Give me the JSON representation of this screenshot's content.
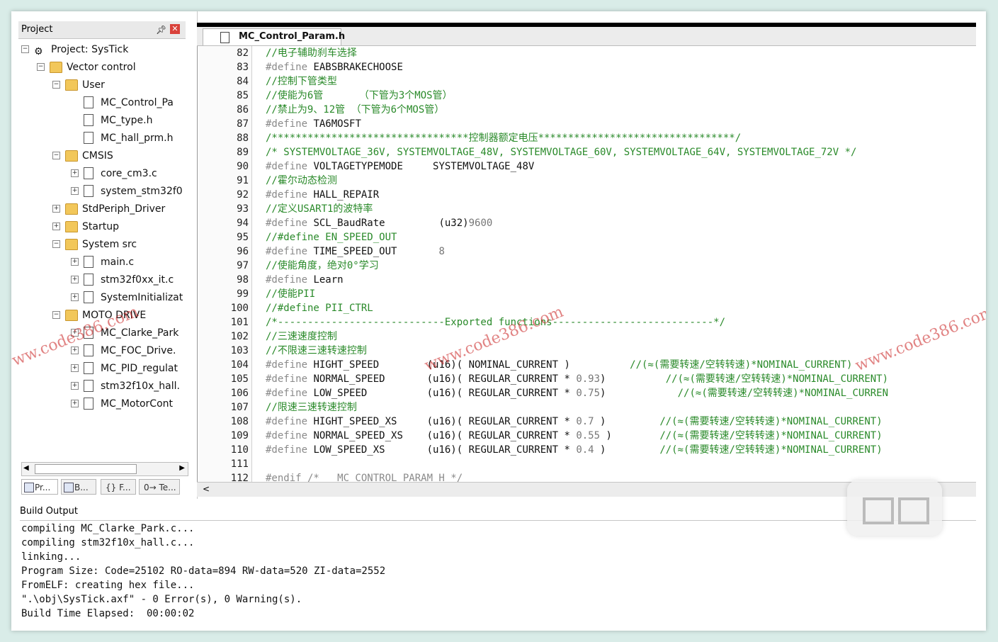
{
  "project_pane": {
    "title": "Project",
    "tree": [
      {
        "label": "Project: SysTick",
        "icon": "project-icon"
      },
      {
        "label": "Vector control",
        "icon": "folder-icon"
      },
      {
        "label": "User",
        "icon": "folder-icon"
      },
      {
        "label": "MC_Control_Pa",
        "icon": "file-icon"
      },
      {
        "label": "MC_type.h",
        "icon": "file-icon"
      },
      {
        "label": "MC_hall_prm.h",
        "icon": "file-icon"
      },
      {
        "label": "CMSIS",
        "icon": "folder-icon"
      },
      {
        "label": "core_cm3.c",
        "icon": "file-icon"
      },
      {
        "label": "system_stm32f0",
        "icon": "file-icon"
      },
      {
        "label": "StdPeriph_Driver",
        "icon": "folder-icon"
      },
      {
        "label": "Startup",
        "icon": "folder-icon"
      },
      {
        "label": "System src",
        "icon": "folder-icon"
      },
      {
        "label": "main.c",
        "icon": "file-icon"
      },
      {
        "label": "stm32f0xx_it.c",
        "icon": "file-icon"
      },
      {
        "label": "SystemInitializat",
        "icon": "file-icon"
      },
      {
        "label": "MOTO DRIVE",
        "icon": "folder-icon"
      },
      {
        "label": "MC_Clarke_Park",
        "icon": "file-icon"
      },
      {
        "label": "MC_FOC_Drive.",
        "icon": "file-icon"
      },
      {
        "label": "MC_PID_regulat",
        "icon": "file-icon"
      },
      {
        "label": "stm32f10x_hall.",
        "icon": "file-icon"
      },
      {
        "label": "MC_MotorCont",
        "icon": "file-icon"
      }
    ],
    "tabs": [
      "Pr...",
      "B...",
      "{} F...",
      "0→ Te..."
    ]
  },
  "editor": {
    "file_tab": "MC_Control_Param.h",
    "lines": [
      {
        "n": "82",
        "segs": [
          {
            "t": "//电子辅助刹车选择",
            "c": "cmt"
          }
        ]
      },
      {
        "n": "83",
        "segs": [
          {
            "t": "#define ",
            "c": "define"
          },
          {
            "t": "EABSBRAKECHOOSE",
            "c": "code"
          }
        ]
      },
      {
        "n": "84",
        "segs": [
          {
            "t": "//控制下管类型",
            "c": "cmt"
          }
        ]
      },
      {
        "n": "85",
        "segs": [
          {
            "t": "//使能为6管      （下管为3个MOS管）",
            "c": "cmt"
          }
        ]
      },
      {
        "n": "86",
        "segs": [
          {
            "t": "//禁止为9、12管 （下管为6个MOS管）",
            "c": "cmt"
          }
        ]
      },
      {
        "n": "87",
        "segs": [
          {
            "t": "#define ",
            "c": "define"
          },
          {
            "t": "TA6MOSFT",
            "c": "code"
          }
        ]
      },
      {
        "n": "88",
        "segs": [
          {
            "t": "/*********************************控制器额定电压*********************************/",
            "c": "cmt"
          }
        ]
      },
      {
        "n": "89",
        "segs": [
          {
            "t": "/* SYSTEMVOLTAGE_36V, SYSTEMVOLTAGE_48V, SYSTEMVOLTAGE_60V, SYSTEMVOLTAGE_64V, SYSTEMVOLTAGE_72V */",
            "c": "cmt"
          }
        ]
      },
      {
        "n": "90",
        "segs": [
          {
            "t": "#define ",
            "c": "define"
          },
          {
            "t": "VOLTAGETYPEMODE     SYSTEMVOLTAGE_48V",
            "c": "code"
          }
        ]
      },
      {
        "n": "91",
        "segs": [
          {
            "t": "//霍尔动态检测",
            "c": "cmt"
          }
        ]
      },
      {
        "n": "92",
        "segs": [
          {
            "t": "#define ",
            "c": "define"
          },
          {
            "t": "HALL_REPAIR",
            "c": "code"
          }
        ]
      },
      {
        "n": "93",
        "segs": [
          {
            "t": "//定义USART1的波特率",
            "c": "cmt"
          }
        ]
      },
      {
        "n": "94",
        "segs": [
          {
            "t": "#define ",
            "c": "define"
          },
          {
            "t": "SCL_BaudRate         (u32)",
            "c": "code"
          },
          {
            "t": "9600",
            "c": "num"
          }
        ]
      },
      {
        "n": "95",
        "segs": [
          {
            "t": "//#define EN_SPEED_OUT",
            "c": "cmt"
          }
        ]
      },
      {
        "n": "96",
        "segs": [
          {
            "t": "#define ",
            "c": "define"
          },
          {
            "t": "TIME_SPEED_OUT       ",
            "c": "code"
          },
          {
            "t": "8",
            "c": "num"
          }
        ]
      },
      {
        "n": "97",
        "segs": [
          {
            "t": "//使能角度，绝对0°学习",
            "c": "cmt"
          }
        ]
      },
      {
        "n": "98",
        "segs": [
          {
            "t": "#define ",
            "c": "define"
          },
          {
            "t": "Learn",
            "c": "code"
          }
        ]
      },
      {
        "n": "99",
        "segs": [
          {
            "t": "//使能PII",
            "c": "cmt"
          }
        ]
      },
      {
        "n": "100",
        "segs": [
          {
            "t": "//#define PII_CTRL",
            "c": "cmt"
          }
        ]
      },
      {
        "n": "101",
        "segs": [
          {
            "t": "/*----------------------------Exported functions---------------------------*/",
            "c": "cmt"
          }
        ]
      },
      {
        "n": "102",
        "segs": [
          {
            "t": "//三速速度控制",
            "c": "cmt"
          }
        ]
      },
      {
        "n": "103",
        "segs": [
          {
            "t": "//不限速三速转速控制",
            "c": "cmt"
          }
        ]
      },
      {
        "n": "104",
        "segs": [
          {
            "t": "#define ",
            "c": "define"
          },
          {
            "t": "HIGHT_SPEED        (u16)( NOMINAL_CURRENT )          ",
            "c": "code"
          },
          {
            "t": "//(≈(需要转速/空转转速)*NOMINAL_CURRENT)",
            "c": "cmt"
          }
        ]
      },
      {
        "n": "105",
        "segs": [
          {
            "t": "#define ",
            "c": "define"
          },
          {
            "t": "NORMAL_SPEED       (u16)( REGULAR_CURRENT * ",
            "c": "code"
          },
          {
            "t": "0.93",
            "c": "num"
          },
          {
            "t": ")          ",
            "c": "code"
          },
          {
            "t": "//(≈(需要转速/空转转速)*NOMINAL_CURRENT)",
            "c": "cmt"
          }
        ]
      },
      {
        "n": "106",
        "segs": [
          {
            "t": "#define ",
            "c": "define"
          },
          {
            "t": "LOW_SPEED          (u16)( REGULAR_CURRENT * ",
            "c": "code"
          },
          {
            "t": "0.75",
            "c": "num"
          },
          {
            "t": ")            ",
            "c": "code"
          },
          {
            "t": "//(≈(需要转速/空转转速)*NOMINAL_CURREN",
            "c": "cmt"
          }
        ]
      },
      {
        "n": "107",
        "segs": [
          {
            "t": "//限速三速转速控制",
            "c": "cmt"
          }
        ]
      },
      {
        "n": "108",
        "segs": [
          {
            "t": "#define ",
            "c": "define"
          },
          {
            "t": "HIGHT_SPEED_XS     (u16)( REGULAR_CURRENT * ",
            "c": "code"
          },
          {
            "t": "0.7",
            "c": "num"
          },
          {
            "t": " )         ",
            "c": "code"
          },
          {
            "t": "//(≈(需要转速/空转转速)*NOMINAL_CURRENT)",
            "c": "cmt"
          }
        ]
      },
      {
        "n": "109",
        "segs": [
          {
            "t": "#define ",
            "c": "define"
          },
          {
            "t": "NORMAL_SPEED_XS    (u16)( REGULAR_CURRENT * ",
            "c": "code"
          },
          {
            "t": "0.55",
            "c": "num"
          },
          {
            "t": " )        ",
            "c": "code"
          },
          {
            "t": "//(≈(需要转速/空转转速)*NOMINAL_CURRENT)",
            "c": "cmt"
          }
        ]
      },
      {
        "n": "110",
        "segs": [
          {
            "t": "#define ",
            "c": "define"
          },
          {
            "t": "LOW_SPEED_XS       (u16)( REGULAR_CURRENT * ",
            "c": "code"
          },
          {
            "t": "0.4",
            "c": "num"
          },
          {
            "t": " )         ",
            "c": "code"
          },
          {
            "t": "//(≈(需要转速/空转转速)*NOMINAL_CURRENT)",
            "c": "cmt"
          }
        ]
      },
      {
        "n": "111",
        "segs": [
          {
            "t": "",
            "c": "code"
          }
        ]
      },
      {
        "n": "112",
        "segs": [
          {
            "t": "#endif /* __MC_CONTROL_PARAM_H */",
            "c": "define"
          }
        ]
      }
    ]
  },
  "build_output": {
    "title": "Build Output",
    "lines": [
      "compiling MC_Clarke_Park.c...",
      "compiling stm32f10x_hall.c...",
      "linking...",
      "Program Size: Code=25102 RO-data=894 RW-data=520 ZI-data=2552",
      "FromELF: creating hex file...",
      "\".\\obj\\SysTick.axf\" - 0 Error(s), 0 Warning(s).",
      "Build Time Elapsed:  00:00:02"
    ]
  },
  "watermarks": [
    "www.code386.com",
    "www.code386.com",
    "www.code386.com"
  ],
  "colors": {
    "comment": "#2a8a2a",
    "define": "#8a8a8a",
    "code": "#111111",
    "watermark": "#c81e1e",
    "close": "#d9413a"
  }
}
